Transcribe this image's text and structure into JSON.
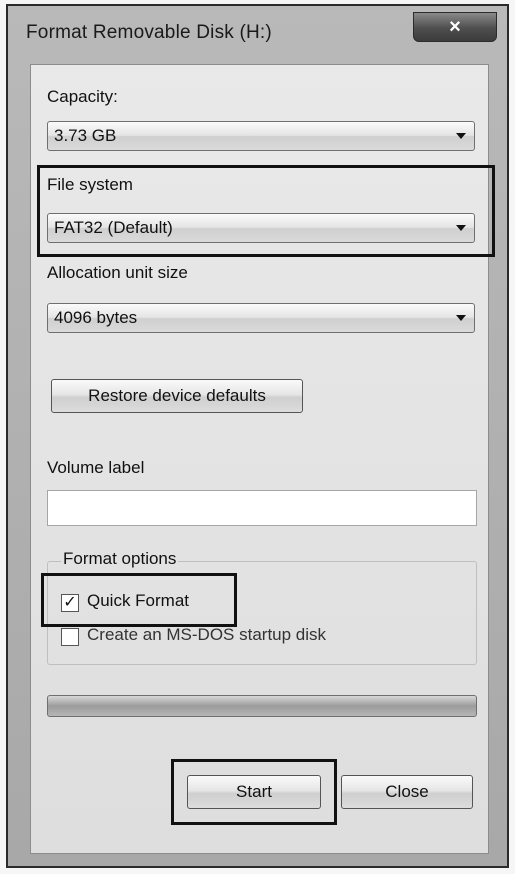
{
  "window": {
    "title": "Format Removable Disk (H:)",
    "close_glyph": "×"
  },
  "capacity": {
    "label": "Capacity:",
    "value": "3.73 GB"
  },
  "file_system": {
    "label": "File system",
    "value": "FAT32 (Default)"
  },
  "allocation": {
    "label": "Allocation unit size",
    "value": "4096 bytes"
  },
  "restore_button": "Restore device defaults",
  "volume_label": {
    "label": "Volume label",
    "value": ""
  },
  "format_options": {
    "legend": "Format options",
    "quick_format": {
      "label": "Quick Format",
      "checked": true,
      "check_glyph": "✓"
    },
    "msdos": {
      "label": "Create an MS-DOS startup disk",
      "checked": false
    }
  },
  "progress": {
    "fraction": 0
  },
  "buttons": {
    "start": "Start",
    "close": "Close"
  },
  "icons": {
    "close": "close-icon",
    "dropdown": "chevron-down-icon",
    "check": "checkmark-icon"
  }
}
